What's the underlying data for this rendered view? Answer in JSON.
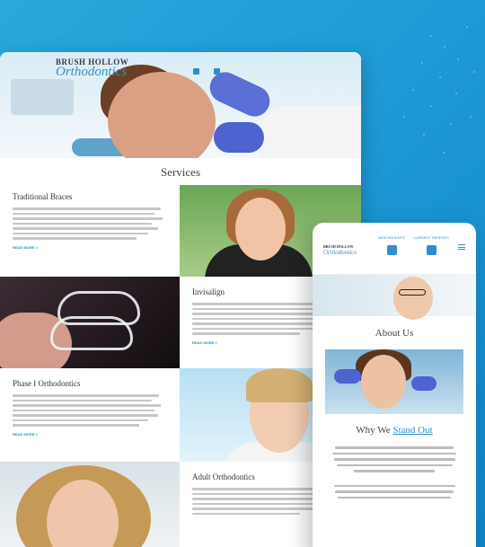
{
  "desktop": {
    "logo_line1": "BRUSH HOLLOW",
    "logo_line2": "Orthodontics",
    "header_contacts": [
      "",
      ""
    ],
    "services_title": "Services",
    "sections": [
      {
        "heading": "Traditional Braces",
        "more": "READ MORE >"
      },
      {
        "heading": "Invisalign",
        "more": "READ MORE >"
      },
      {
        "heading": "Phase I Orthodontics",
        "more": "READ MORE >"
      },
      {
        "heading": "Adult Orthodontics",
        "more": ""
      }
    ]
  },
  "mobile": {
    "logo_line1": "BRUSH HOLLOW",
    "logo_line2": "Orthodontics",
    "action1": "NEW PATIENTS",
    "action2": "CURRENT PATIENTS",
    "about_title": "About Us",
    "why_prefix": "Why We ",
    "why_highlight": "Stand Out"
  },
  "colors": {
    "accent": "#2c8fcf",
    "background": "#1e9ad6"
  }
}
